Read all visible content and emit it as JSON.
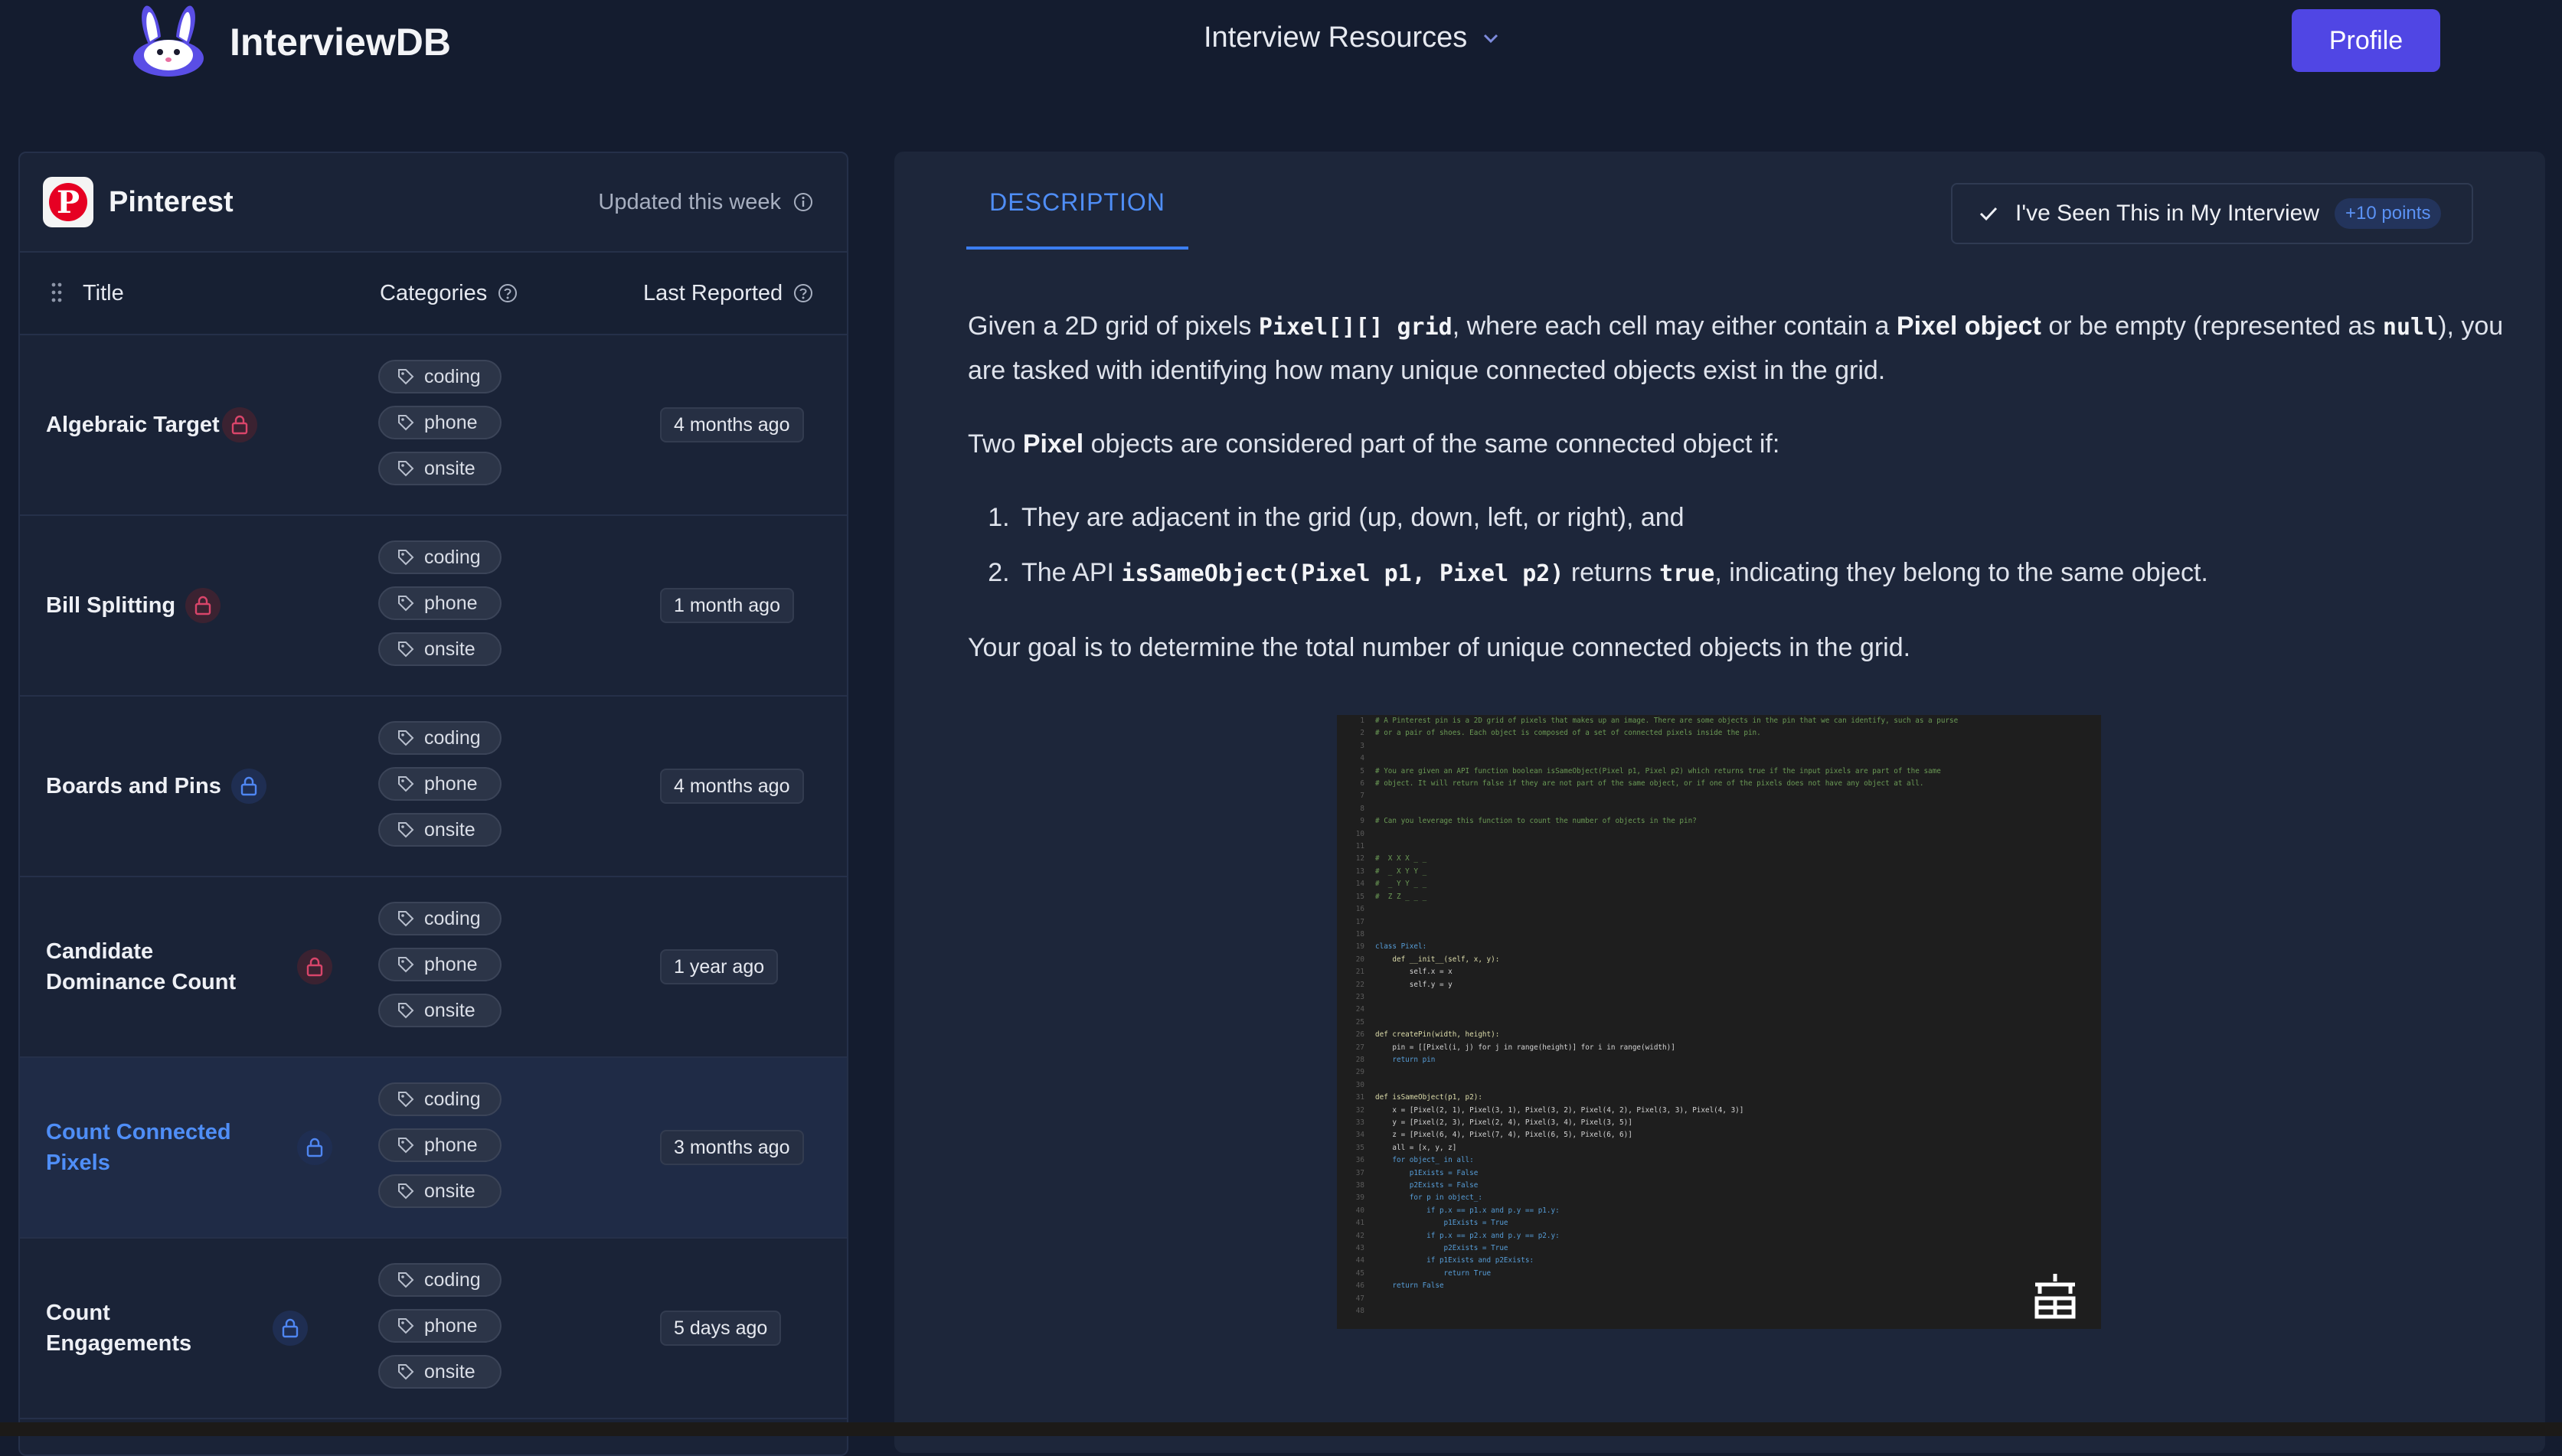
{
  "header": {
    "app_name": "InterviewDB",
    "nav_resources": "Interview Resources",
    "profile_label": "Profile"
  },
  "company": {
    "name": "Pinterest",
    "updated": "Updated this week"
  },
  "table": {
    "columns": [
      "Title",
      "Categories",
      "Last Reported"
    ],
    "rows": [
      {
        "title": "Algebraic Target",
        "tags": [
          "coding",
          "phone",
          "onsite"
        ],
        "reported": "4 months ago",
        "lock": "red"
      },
      {
        "title": "Bill Splitting",
        "tags": [
          "coding",
          "phone",
          "onsite"
        ],
        "reported": "1 month ago",
        "lock": "red"
      },
      {
        "title": "Boards and Pins",
        "tags": [
          "coding",
          "phone",
          "onsite"
        ],
        "reported": "4 months ago",
        "lock": "blue"
      },
      {
        "title": "Candidate Dominance Count",
        "tags": [
          "coding",
          "phone",
          "onsite"
        ],
        "reported": "1 year ago",
        "lock": "red"
      },
      {
        "title": "Count Connected Pixels",
        "tags": [
          "coding",
          "phone",
          "onsite"
        ],
        "reported": "3 months ago",
        "lock": "blue",
        "selected": true
      },
      {
        "title": "Count Engagements",
        "tags": [
          "coding",
          "phone",
          "onsite"
        ],
        "reported": "5 days ago",
        "lock": "blue"
      }
    ]
  },
  "detail": {
    "tab": "DESCRIPTION",
    "seen_label": "I've Seen This in My Interview",
    "points": "+10 points",
    "p1_a": "Given a 2D grid of pixels ",
    "p1_code1": "Pixel[][] grid",
    "p1_b": ", where each cell may either contain a ",
    "p1_bold": "Pixel object",
    "p1_c": " or be empty (represented as ",
    "p1_code2": "null",
    "p1_d": "), you are tasked with identifying how many unique connected objects exist in the grid.",
    "p2_a": "Two ",
    "p2_bold": "Pixel",
    "p2_b": " objects are considered part of the same connected object if:",
    "li1": "They are adjacent in the grid (up, down, left, or right), and",
    "li2_a": "The API ",
    "li2_code1": "isSameObject(Pixel p1, Pixel p2)",
    "li2_b": " returns ",
    "li2_code2": "true",
    "li2_c": ", indicating they belong to the same object.",
    "p3": "Your goal is to determine the total number of unique connected objects in the grid."
  },
  "code_image": {
    "lines": [
      [
        "cm",
        "# A Pinterest pin is a 2D grid of pixels that makes up an image. There are some objects in the pin that we can identify, such as a purse"
      ],
      [
        "cm",
        "# or a pair of shoes. Each object is composed of a set of connected pixels inside the pin."
      ],
      [
        "tx",
        ""
      ],
      [
        "tx",
        ""
      ],
      [
        "cm",
        "# You are given an API function boolean isSameObject(Pixel p1, Pixel p2) which returns true if the input pixels are part of the same"
      ],
      [
        "cm",
        "# object. It will return false if they are not part of the same object, or if one of the pixels does not have any object at all."
      ],
      [
        "tx",
        ""
      ],
      [
        "tx",
        ""
      ],
      [
        "cm",
        "# Can you leverage this function to count the number of objects in the pin?"
      ],
      [
        "tx",
        ""
      ],
      [
        "tx",
        ""
      ],
      [
        "cm",
        "#  X X X _ _"
      ],
      [
        "cm",
        "#  _ X Y Y _"
      ],
      [
        "cm",
        "#  _ Y Y _ _"
      ],
      [
        "cm",
        "#  Z Z _ _ _"
      ],
      [
        "tx",
        ""
      ],
      [
        "tx",
        ""
      ],
      [
        "tx",
        ""
      ],
      [
        "kw",
        "class Pixel:"
      ],
      [
        "fn",
        "    def __init__(self, x, y):"
      ],
      [
        "tx",
        "        self.x = x"
      ],
      [
        "tx",
        "        self.y = y"
      ],
      [
        "tx",
        ""
      ],
      [
        "tx",
        ""
      ],
      [
        "tx",
        ""
      ],
      [
        "fn",
        "def createPin(width, height):"
      ],
      [
        "tx",
        "    pin = [[Pixel(i, j) for j in range(height)] for i in range(width)]"
      ],
      [
        "kw",
        "    return pin"
      ],
      [
        "tx",
        ""
      ],
      [
        "tx",
        ""
      ],
      [
        "fn",
        "def isSameObject(p1, p2):"
      ],
      [
        "tx",
        "    x = [Pixel(2, 1), Pixel(3, 1), Pixel(3, 2), Pixel(4, 2), Pixel(3, 3), Pixel(4, 3)]"
      ],
      [
        "tx",
        "    y = [Pixel(2, 3), Pixel(2, 4), Pixel(3, 4), Pixel(3, 5)]"
      ],
      [
        "tx",
        "    z = [Pixel(6, 4), Pixel(7, 4), Pixel(6, 5), Pixel(6, 6)]"
      ],
      [
        "tx",
        "    all = [x, y, z]"
      ],
      [
        "kw",
        "    for object_ in all:"
      ],
      [
        "kw",
        "        p1Exists = False"
      ],
      [
        "kw",
        "        p2Exists = False"
      ],
      [
        "kw",
        "        for p in object_:"
      ],
      [
        "kw",
        "            if p.x == p1.x and p.y == p1.y:"
      ],
      [
        "kw",
        "                p1Exists = True"
      ],
      [
        "kw",
        "            if p.x == p2.x and p.y == p2.y:"
      ],
      [
        "kw",
        "                p2Exists = True"
      ],
      [
        "kw",
        "            if p1Exists and p2Exists:"
      ],
      [
        "kw",
        "                return True"
      ],
      [
        "kw",
        "    return False"
      ],
      [
        "tx",
        ""
      ],
      [
        "tx",
        ""
      ]
    ]
  }
}
